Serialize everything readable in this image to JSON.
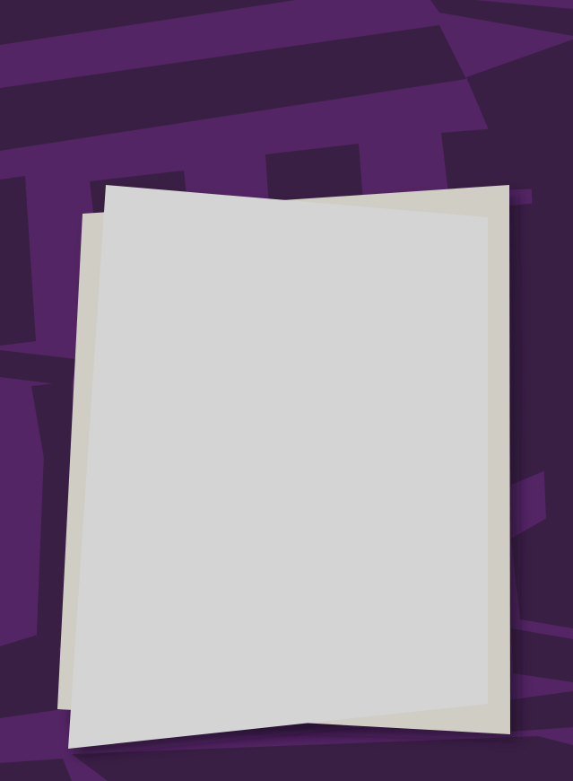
{
  "background": {
    "pattern": "overlapping-stripes",
    "colors": {
      "base": "#532564",
      "dark_stripe": "#3a1f44",
      "edge_accent": "#6e1f36"
    }
  },
  "papers": {
    "back_sheet_color": "#d0cdc5",
    "front_sheet_color": "#d4d4d4",
    "shadow_color": "#1e0f25",
    "content": ""
  }
}
